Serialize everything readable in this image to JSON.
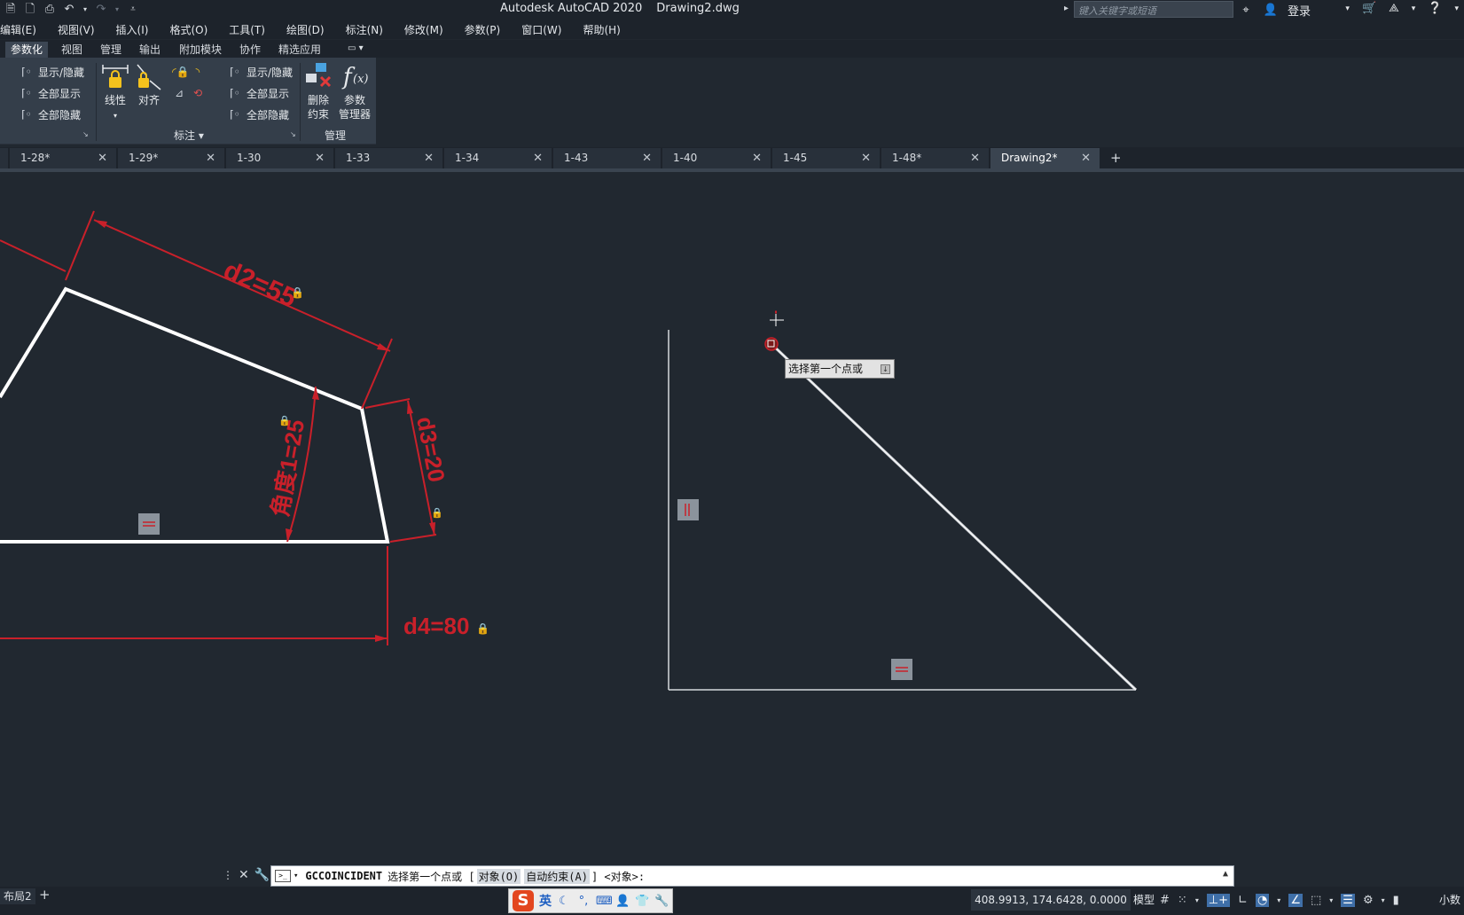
{
  "title": {
    "app": "Autodesk AutoCAD 2020",
    "file": "Drawing2.dwg",
    "search_placeholder": "键入关键字或短语",
    "login": "登录"
  },
  "menu": [
    "编辑(E)",
    "视图(V)",
    "插入(I)",
    "格式(O)",
    "工具(T)",
    "绘图(D)",
    "标注(N)",
    "修改(M)",
    "参数(P)",
    "窗口(W)",
    "帮助(H)"
  ],
  "ribbon_tabs": [
    "参数化",
    "视图",
    "管理",
    "输出",
    "附加模块",
    "协作",
    "精选应用"
  ],
  "ribbon": {
    "geo_show_hide": "显示/隐藏",
    "geo_show_all": "全部显示",
    "geo_hide_all": "全部隐藏",
    "linear": "线性",
    "aligned": "对齐",
    "dim_show_hide": "显示/隐藏",
    "dim_show_all": "全部显示",
    "dim_hide_all": "全部隐藏",
    "delete_constraint_1": "删除",
    "delete_constraint_2": "约束",
    "param_manager_1": "参数",
    "param_manager_2": "管理器",
    "panel_dimension": "标注",
    "panel_manage": "管理"
  },
  "file_tabs": [
    "1-28*",
    "1-29*",
    "1-30",
    "1-33",
    "1-34",
    "1-43",
    "1-40",
    "1-45",
    "1-48*",
    "Drawing2*"
  ],
  "drawing": {
    "dim_d2": "d2=55",
    "dim_angle": "角度1=25",
    "dim_d3": "d3=20",
    "dim_d4": "d4=80",
    "tooltip": "选择第一个点或"
  },
  "command": {
    "name": "GCCOINCIDENT",
    "prompt": "选择第一个点或 [",
    "opt_object": "对象(O)",
    "opt_auto": "自动约束(A)",
    "tail": "] <对象>:"
  },
  "status": {
    "layout": "布局2",
    "ime_lang": "英",
    "coordinates": "408.9913, 174.6428, 0.0000",
    "model": "模型",
    "units": "小数"
  },
  "colors": {
    "background": "#212830",
    "dimension": "#c9202a",
    "geometry": "#ffffff",
    "ribbon": "#343e4a"
  }
}
